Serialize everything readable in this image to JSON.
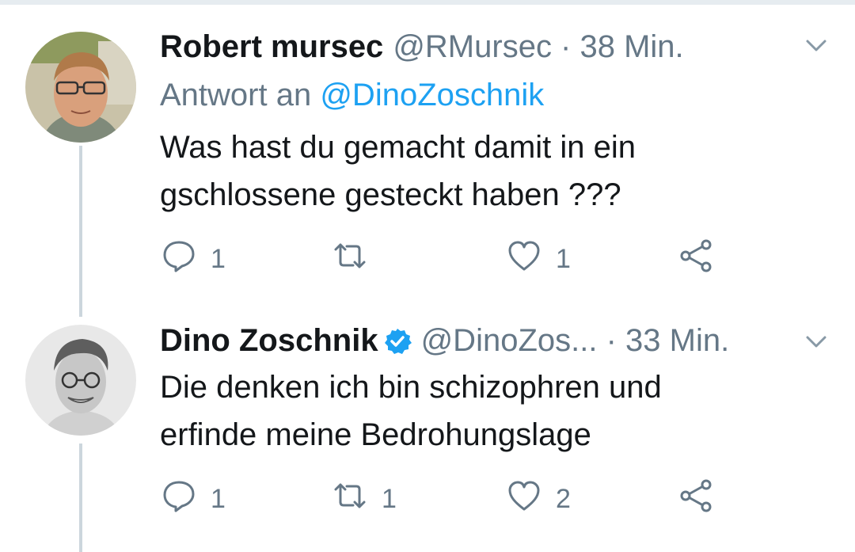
{
  "tweets": [
    {
      "display_name": "Robert mursec",
      "handle_meta": "@RMursec · 38 Min.",
      "reply_prefix": "Antwort an ",
      "reply_mention": "@DinoZoschnik",
      "text_lines": [
        "Was hast du gemacht damit in ein",
        "gschlossene gesteckt haben ???"
      ],
      "reply_count": "1",
      "retweet_count": "",
      "like_count": "1",
      "verified": false
    },
    {
      "display_name": "Dino Zoschnik",
      "handle_meta": "@DinoZos... · 33 Min.",
      "text_lines": [
        "Die denken ich bin schizophren und",
        "erfinde meine Bedrohungslage"
      ],
      "reply_count": "1",
      "retweet_count": "1",
      "like_count": "2",
      "verified": true
    }
  ],
  "icons": {
    "reply": "speech-bubble-icon",
    "retweet": "retweet-icon",
    "like": "heart-icon",
    "share": "share-icon",
    "menu": "chevron-down-icon",
    "verified": "verified-badge-icon"
  },
  "colors": {
    "text": "#14171a",
    "secondary": "#657786",
    "link": "#1da1f2",
    "thread_line": "#ccd6dd"
  }
}
